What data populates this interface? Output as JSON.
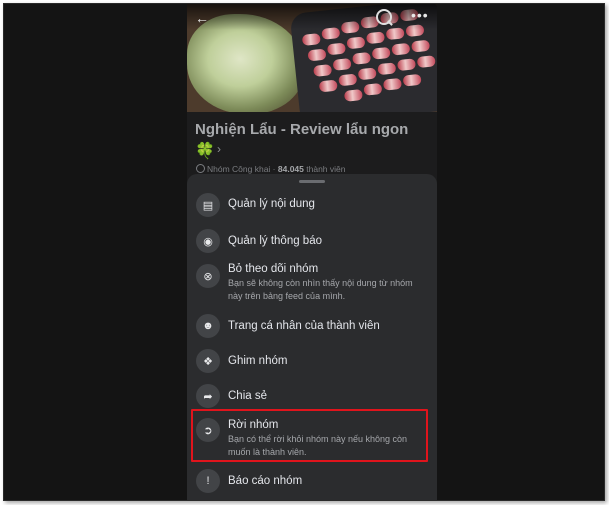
{
  "group": {
    "name": "Nghiện Lẩu - Review lẩu ngon",
    "privacy": "Nhóm Công khai",
    "members_count": "84.045",
    "members_suffix": "thành viên",
    "emoji": "🍀"
  },
  "topbar": {
    "back_icon": "arrow-left-icon",
    "search_icon": "search-icon",
    "more_icon": "more-horizontal-icon"
  },
  "menu": [
    {
      "icon": "content-manage-icon",
      "label": "Quản lý nội dung"
    },
    {
      "icon": "bell-icon",
      "label": "Quản lý thông báo"
    },
    {
      "icon": "unfollow-icon",
      "label": "Bỏ theo dõi nhóm",
      "sub": "Bạn sẽ không còn nhìn thấy nội dung từ nhóm này trên bảng feed của mình."
    },
    {
      "icon": "member-profile-icon",
      "label": "Trang cá nhân của thành viên"
    },
    {
      "icon": "pin-icon",
      "label": "Ghim nhóm"
    },
    {
      "icon": "share-icon",
      "label": "Chia sẻ"
    },
    {
      "icon": "leave-group-icon",
      "label": "Rời nhóm",
      "sub": "Bạn có thể rời khỏi nhóm này nếu không còn muốn là thành viên."
    },
    {
      "icon": "report-icon",
      "label": "Báo cáo nhóm"
    }
  ],
  "colors": {
    "highlight": "#e0141c",
    "sheet": "#2b2c2e",
    "text": "#e4e6eb"
  }
}
